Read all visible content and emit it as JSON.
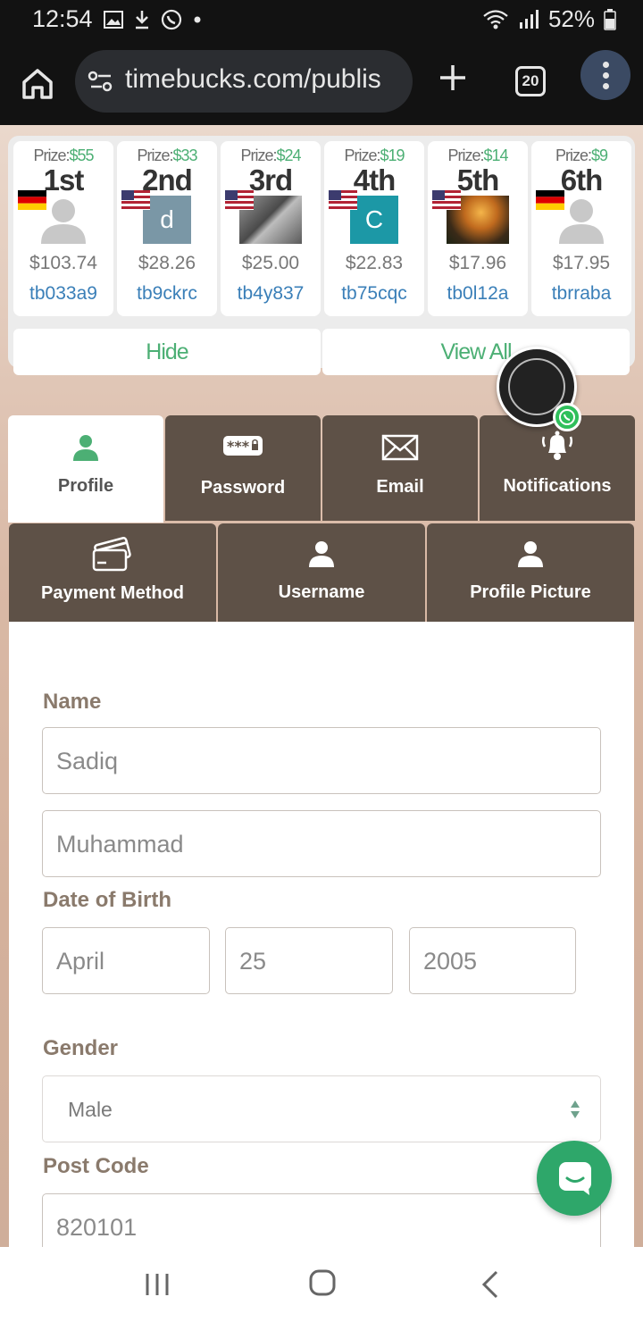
{
  "status_bar": {
    "time": "12:54",
    "battery": "52%"
  },
  "browser": {
    "url": "timebucks.com/publis",
    "tab_count": "20"
  },
  "leaderboard": {
    "entries": [
      {
        "prize_label": "Prize:",
        "prize_value": "$55",
        "rank": "1st",
        "flag": "germany-flag",
        "avatar": "default-avatar",
        "amount": "$103.74",
        "user": "tb033a9"
      },
      {
        "prize_label": "Prize:",
        "prize_value": "$33",
        "rank": "2nd",
        "flag": "usa-flag",
        "avatar": "letter-avatar",
        "avatar_letter": "d",
        "avatar_color": "#7a97a6",
        "amount": "$28.26",
        "user": "tb9ckrc"
      },
      {
        "prize_label": "Prize:",
        "prize_value": "$24",
        "rank": "3rd",
        "flag": "usa-flag",
        "avatar": "photo-avatar",
        "amount": "$25.00",
        "user": "tb4y837"
      },
      {
        "prize_label": "Prize:",
        "prize_value": "$19",
        "rank": "4th",
        "flag": "usa-flag",
        "avatar": "letter-avatar",
        "avatar_letter": "C",
        "avatar_color": "#1c98a6",
        "amount": "$22.83",
        "user": "tb75cqc"
      },
      {
        "prize_label": "Prize:",
        "prize_value": "$14",
        "rank": "5th",
        "flag": "usa-flag",
        "avatar": "photo-avatar",
        "amount": "$17.96",
        "user": "tb0l12a"
      },
      {
        "prize_label": "Prize:",
        "prize_value": "$9",
        "rank": "6th",
        "flag": "germany-flag",
        "avatar": "default-avatar",
        "amount": "$17.95",
        "user": "tbrraba"
      }
    ],
    "hide_label": "Hide",
    "view_all_label": "View All"
  },
  "tabs": {
    "profile": "Profile",
    "password": "Password",
    "email": "Email",
    "notifications": "Notifications",
    "payment_method": "Payment Method",
    "username": "Username",
    "profile_picture": "Profile Picture"
  },
  "form": {
    "name_label": "Name",
    "first_name": "Sadiq",
    "last_name": "Muhammad",
    "dob_label": "Date of Birth",
    "dob_month": "April",
    "dob_day": "25",
    "dob_year": "2005",
    "gender_label": "Gender",
    "gender_value": "Male",
    "postcode_label": "Post Code",
    "postcode_value": "820101"
  },
  "colors": {
    "accent_green": "#4caf74",
    "tab_brown": "#5e5147",
    "link_blue": "#3a7fb8",
    "chat_green": "#2ea76a"
  }
}
